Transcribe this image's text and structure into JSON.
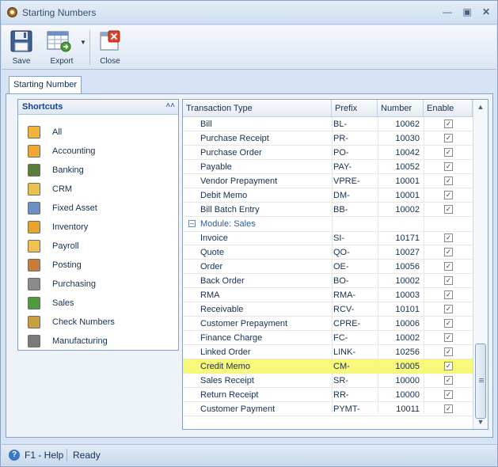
{
  "window": {
    "title": "Starting Numbers",
    "minimize_icon": "minimize-icon",
    "maximize_icon": "maximize-icon",
    "close_icon": "close-icon"
  },
  "toolbar": {
    "buttons": [
      {
        "label": "Save",
        "icon": "save-icon"
      },
      {
        "label": "Export",
        "icon": "export-icon",
        "dropdown": true
      },
      {
        "label": "Close",
        "icon": "close-doc-icon"
      }
    ]
  },
  "tabs": [
    {
      "label": "Starting Number",
      "selected": true
    }
  ],
  "shortcuts": {
    "title": "Shortcuts",
    "items": [
      {
        "label": "All",
        "icon": "all-icon"
      },
      {
        "label": "Accounting",
        "icon": "accounting-icon"
      },
      {
        "label": "Banking",
        "icon": "banking-icon"
      },
      {
        "label": "CRM",
        "icon": "crm-icon"
      },
      {
        "label": "Fixed Asset",
        "icon": "fixed-asset-icon"
      },
      {
        "label": "Inventory",
        "icon": "inventory-icon"
      },
      {
        "label": "Payroll",
        "icon": "payroll-icon"
      },
      {
        "label": "Posting",
        "icon": "posting-icon"
      },
      {
        "label": "Purchasing",
        "icon": "purchasing-icon"
      },
      {
        "label": "Sales",
        "icon": "sales-icon"
      },
      {
        "label": "Check Numbers",
        "icon": "check-numbers-icon"
      },
      {
        "label": "Manufacturing",
        "icon": "manufacturing-icon"
      }
    ]
  },
  "grid": {
    "columns": [
      "Transaction Type",
      "Prefix",
      "Number",
      "Enable"
    ],
    "rows_top": [
      {
        "type": "Bill",
        "prefix": "BL-",
        "number": "10062",
        "enable": true
      },
      {
        "type": "Purchase Receipt",
        "prefix": "PR-",
        "number": "10030",
        "enable": true
      },
      {
        "type": "Purchase Order",
        "prefix": "PO-",
        "number": "10042",
        "enable": true
      },
      {
        "type": "Payable",
        "prefix": "PAY-",
        "number": "10052",
        "enable": true
      },
      {
        "type": "Vendor Prepayment",
        "prefix": "VPRE-",
        "number": "10001",
        "enable": true
      },
      {
        "type": "Debit Memo",
        "prefix": "DM-",
        "number": "10001",
        "enable": true
      },
      {
        "type": "Bill Batch Entry",
        "prefix": "BB-",
        "number": "10002",
        "enable": true
      }
    ],
    "group_label": "Module: Sales",
    "rows_sales": [
      {
        "type": "Invoice",
        "prefix": "SI-",
        "number": "10171",
        "enable": true
      },
      {
        "type": "Quote",
        "prefix": "QO-",
        "number": "10027",
        "enable": true
      },
      {
        "type": "Order",
        "prefix": "OE-",
        "number": "10056",
        "enable": true
      },
      {
        "type": "Back Order",
        "prefix": "BO-",
        "number": "10002",
        "enable": true
      },
      {
        "type": "RMA",
        "prefix": "RMA-",
        "number": "10003",
        "enable": true
      },
      {
        "type": "Receivable",
        "prefix": "RCV-",
        "number": "10101",
        "enable": true
      },
      {
        "type": "Customer Prepayment",
        "prefix": "CPRE-",
        "number": "10006",
        "enable": true
      },
      {
        "type": "Finance Charge",
        "prefix": "FC-",
        "number": "10002",
        "enable": true
      },
      {
        "type": "Linked Order",
        "prefix": "LINK-",
        "number": "10256",
        "enable": true
      },
      {
        "type": "Credit Memo",
        "prefix": "CM-",
        "number": "10005",
        "enable": true,
        "highlighted": true
      },
      {
        "type": "Sales Receipt",
        "prefix": "SR-",
        "number": "10000",
        "enable": true
      },
      {
        "type": "Return Receipt",
        "prefix": "RR-",
        "number": "10000",
        "enable": true
      },
      {
        "type": "Customer Payment",
        "prefix": "PYMT-",
        "number": "10011",
        "enable": true
      }
    ],
    "highlight_color": "#f8f87a"
  },
  "statusbar": {
    "help": "F1 - Help",
    "status": "Ready",
    "help_icon": "help-icon"
  }
}
